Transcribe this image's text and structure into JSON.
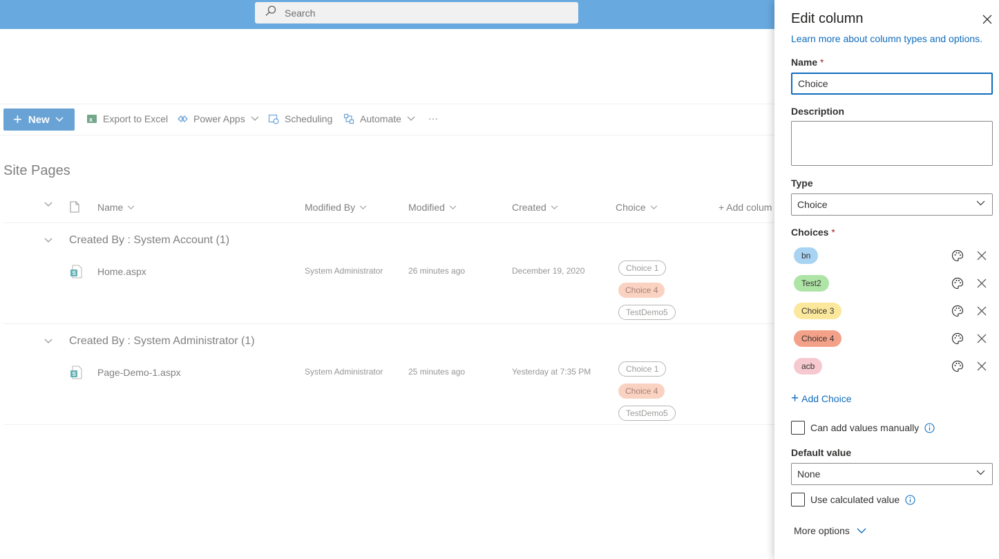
{
  "search": {
    "placeholder": "Search"
  },
  "toolbar": {
    "new_label": "New",
    "export_label": "Export to Excel",
    "powerapps_label": "Power Apps",
    "scheduling_label": "Scheduling",
    "automate_label": "Automate",
    "more_label": "···"
  },
  "page_title": "Site Pages",
  "columns": {
    "name": "Name",
    "modified_by": "Modified By",
    "modified": "Modified",
    "created": "Created",
    "choice": "Choice",
    "add_column": "+ Add colum"
  },
  "groups": [
    {
      "header": "Created By : System Account (1)",
      "file": "Home.aspx",
      "modified_by": "System Administrator",
      "modified": "26 minutes ago",
      "created": "December 19, 2020",
      "choices": [
        "Choice 1",
        "Choice 4",
        "TestDemo5"
      ]
    },
    {
      "header": "Created By : System Administrator (1)",
      "file": "Page-Demo-1.aspx",
      "modified_by": "System Administrator",
      "modified": "25 minutes ago",
      "created": "Yesterday at 7:35 PM",
      "choices": [
        "Choice 1",
        "Choice 4",
        "TestDemo5"
      ]
    }
  ],
  "panel": {
    "title": "Edit column",
    "learn_link": "Learn more about column types and options.",
    "name_label": "Name",
    "required_mark": "*",
    "name_value": "Choice",
    "description_label": "Description",
    "type_label": "Type",
    "type_value": "Choice",
    "choices_label": "Choices",
    "choices": [
      {
        "label": "bn",
        "color": "#a9d3f2"
      },
      {
        "label": "Test2",
        "color": "#aee5a6"
      },
      {
        "label": "Choice 3",
        "color": "#fce89c"
      },
      {
        "label": "Choice 4",
        "color": "#f4a189"
      },
      {
        "label": "acb",
        "color": "#f6c9d0"
      }
    ],
    "add_choice_label": "Add Choice",
    "manual_label": "Can add values manually",
    "default_label": "Default value",
    "default_value": "None",
    "calculated_label": "Use calculated value",
    "more_options_label": "More options"
  },
  "colors": {
    "accent": "#0f6cbd",
    "topbar": "#68a9e0"
  }
}
